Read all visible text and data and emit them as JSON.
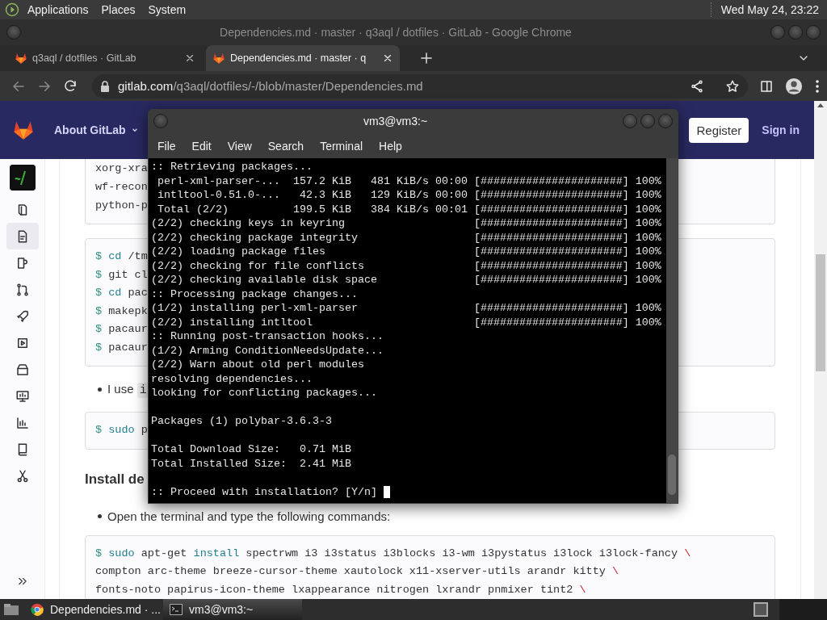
{
  "top_panel": {
    "menus": [
      "Applications",
      "Places",
      "System"
    ],
    "clock": "Wed May 24, 23:22"
  },
  "browser": {
    "title": "Dependencies.md · master · q3aql / dotfiles · GitLab - Google Chrome",
    "tabs": [
      {
        "label": "q3aql / dotfiles · GitLab",
        "selected": false
      },
      {
        "label": "Dependencies.md · master · q",
        "selected": true
      }
    ],
    "nav": {
      "back_disabled": true,
      "forward_disabled": true
    },
    "url": {
      "host": "gitlab.com",
      "path": "/q3aql/dotfiles/-/blob/master/Dependencies.md"
    }
  },
  "gitlab": {
    "navbar": {
      "about": "About GitLab",
      "register": "Register",
      "sign_in": "Sign in"
    },
    "sidebar": {
      "items": [
        {
          "selected": false
        },
        {
          "selected": true
        },
        {
          "selected": false
        },
        {
          "selected": false
        },
        {
          "selected": false
        },
        {
          "selected": false
        },
        {
          "selected": false
        },
        {
          "selected": false
        },
        {
          "selected": false
        },
        {
          "selected": false
        },
        {
          "selected": false
        }
      ]
    },
    "content": [
      {
        "kind": "code",
        "lines": [
          [
            {
              "kind": "plain",
              "text": "xorg-xra"
            }
          ],
          [
            {
              "kind": "plain",
              "text": "wf-recon"
            }
          ],
          [
            {
              "kind": "plain",
              "text": "python-p"
            }
          ]
        ]
      },
      {
        "kind": "code",
        "lines": [
          [
            {
              "kind": "prompt",
              "text": "$ "
            },
            {
              "kind": "keyword",
              "text": "cd"
            },
            {
              "kind": "plain",
              "text": " /tm"
            }
          ],
          [
            {
              "kind": "prompt",
              "text": "$ "
            },
            {
              "kind": "plain",
              "text": "git cl"
            }
          ],
          [
            {
              "kind": "prompt",
              "text": "$ "
            },
            {
              "kind": "keyword",
              "text": "cd"
            },
            {
              "kind": "plain",
              "text": " pac"
            }
          ],
          [
            {
              "kind": "prompt",
              "text": "$ "
            },
            {
              "kind": "plain",
              "text": "makepk"
            }
          ],
          [
            {
              "kind": "prompt",
              "text": "$ "
            },
            {
              "kind": "plain",
              "text": "pacaur"
            }
          ],
          [
            {
              "kind": "prompt",
              "text": "$ "
            },
            {
              "kind": "plain",
              "text": "pacaur"
            }
          ]
        ]
      },
      {
        "kind": "bullet",
        "parts": [
          {
            "kind": "plain",
            "text": "I use "
          },
          {
            "kind": "code",
            "text": "i"
          }
        ]
      },
      {
        "kind": "code",
        "lines": [
          [
            {
              "kind": "prompt",
              "text": "$ "
            },
            {
              "kind": "keyword",
              "text": "sudo"
            },
            {
              "kind": "plain",
              "text": " p"
            }
          ]
        ]
      },
      {
        "kind": "heading",
        "text": "Install de"
      },
      {
        "kind": "bullet",
        "parts": [
          {
            "kind": "plain",
            "text": "Open the terminal and type the following commands:"
          }
        ]
      },
      {
        "kind": "code",
        "lines": [
          [
            {
              "kind": "prompt",
              "text": "$ "
            },
            {
              "kind": "keyword",
              "text": "sudo"
            },
            {
              "kind": "plain",
              "text": " apt-get "
            },
            {
              "kind": "keyword",
              "text": "install"
            },
            {
              "kind": "plain",
              "text": " spectrwm i3 i3status i3blocks i3-wm i3pystatus i3lock i3lock-fancy "
            },
            {
              "kind": "continuation",
              "text": "\\"
            }
          ],
          [
            {
              "kind": "plain",
              "text": "compton arc-theme breeze-cursor-theme xautolock x11-xserver-utils arandr kitty "
            },
            {
              "kind": "continuation",
              "text": "\\"
            }
          ],
          [
            {
              "kind": "plain",
              "text": "fonts-noto papirus-icon-theme lxappearance nitrogen lxrandr pnmixer tint2 "
            },
            {
              "kind": "continuation",
              "text": "\\"
            }
          ]
        ]
      }
    ]
  },
  "terminal": {
    "title": "vm3@vm3:~",
    "menu": [
      "File",
      "Edit",
      "View",
      "Search",
      "Terminal",
      "Help"
    ],
    "cursor_visible": true,
    "lines": [
      {
        "kind": "text",
        "text": ":: Retrieving packages..."
      },
      {
        "kind": "text",
        "text": " perl-xml-parser-...  157.2 KiB   481 KiB/s 00:00 [######################] 100%"
      },
      {
        "kind": "text",
        "text": " intltool-0.51.0-...   42.3 KiB   129 KiB/s 00:00 [######################] 100%"
      },
      {
        "kind": "text",
        "text": " Total (2/2)          199.5 KiB   384 KiB/s 00:01 [######################] 100%"
      },
      {
        "kind": "text",
        "text": "(2/2) checking keys in keyring                    [######################] 100%"
      },
      {
        "kind": "text",
        "text": "(2/2) checking package integrity                  [######################] 100%"
      },
      {
        "kind": "text",
        "text": "(2/2) loading package files                       [######################] 100%"
      },
      {
        "kind": "text",
        "text": "(2/2) checking for file conflicts                 [######################] 100%"
      },
      {
        "kind": "text",
        "text": "(2/2) checking available disk space               [######################] 100%"
      },
      {
        "kind": "text",
        "text": ":: Processing package changes..."
      },
      {
        "kind": "text",
        "text": "(1/2) installing perl-xml-parser                  [######################] 100%"
      },
      {
        "kind": "text",
        "text": "(2/2) installing intltool                         [######################] 100%"
      },
      {
        "kind": "text",
        "text": ":: Running post-transaction hooks..."
      },
      {
        "kind": "text",
        "text": "(1/2) Arming ConditionNeedsUpdate..."
      },
      {
        "kind": "text",
        "text": "(2/2) Warn about old perl modules"
      },
      {
        "kind": "text",
        "text": "resolving dependencies..."
      },
      {
        "kind": "text",
        "text": "looking for conflicting packages..."
      },
      {
        "kind": "blank"
      },
      {
        "kind": "text",
        "text": "Packages (1) polybar-3.6.3-3"
      },
      {
        "kind": "blank"
      },
      {
        "kind": "text",
        "text": "Total Download Size:   0.71 MiB"
      },
      {
        "kind": "text",
        "text": "Total Installed Size:  2.41 MiB"
      },
      {
        "kind": "blank"
      },
      {
        "kind": "text",
        "text": ":: Proceed with installation? [Y/n] "
      }
    ]
  },
  "taskbar": {
    "items": [
      {
        "kind": "browser",
        "label": "Dependencies.md · ...",
        "selected": false
      },
      {
        "kind": "terminal",
        "label": "vm3@vm3:~",
        "selected": true
      }
    ]
  }
}
